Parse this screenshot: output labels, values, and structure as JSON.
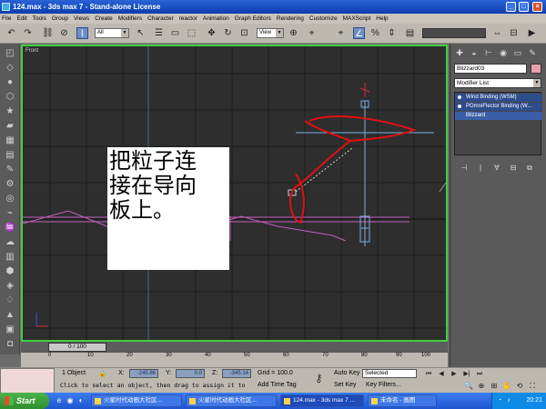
{
  "window": {
    "title": "124.max - 3ds max 7 - Stand-alone License",
    "minimize_glyph": "_",
    "maximize_glyph": "□",
    "close_glyph": "×"
  },
  "menubar": {
    "items": [
      "File",
      "Edit",
      "Tools",
      "Group",
      "Views",
      "Create",
      "Modifiers",
      "Character",
      "reactor",
      "Animation",
      "Graph Editors",
      "Rendering",
      "Customize",
      "MAXScript",
      "Help"
    ]
  },
  "toolbar": {
    "selection_filter": "All",
    "reference_coord": "View",
    "undo_glyph": "↶",
    "redo_glyph": "↷",
    "link_glyph": "⛓",
    "unlink_glyph": "⊘",
    "bind_spacewarp_glyph": "⌇",
    "select_glyph": "↖",
    "select_by_name_glyph": "☰",
    "region_glyph": "▭",
    "crossing_glyph": "⬚",
    "move_glyph": "✥",
    "rotate_glyph": "↻",
    "scale_glyph": "⊡",
    "pivot_glyph": "⊕",
    "snap_glyph": "⌖",
    "angle_snap_glyph": "∠",
    "percent_snap_glyph": "%",
    "spinner_snap_glyph": "⇕",
    "named_sel_glyph": "▤",
    "mirror_glyph": "⇔",
    "align_glyph": "⊟",
    "render_glyph": "☕",
    "quick_render_glyph": "▶"
  },
  "left_tools": {
    "glyphs": [
      "◰",
      "◇",
      "●",
      "⬡",
      "★",
      "▰",
      "▦",
      "▤",
      "✎",
      "⚙",
      "◎",
      "⌁",
      "♒",
      "☁",
      "▥",
      "⬢",
      "◈",
      "♢",
      "▲",
      "▣",
      "◘",
      "▨"
    ]
  },
  "viewport": {
    "label": "Front",
    "border_color": "#3fd03f",
    "grid_color": "#1e1e1e",
    "axis_color": "#000000"
  },
  "annotation": {
    "text": "把粒子连接在导向板上。"
  },
  "timebar": {
    "frame_display": "0 / 100",
    "ticks": [
      "0",
      "10",
      "20",
      "30",
      "40",
      "50",
      "60",
      "70",
      "80",
      "90",
      "100"
    ]
  },
  "command_panel": {
    "object_name": "Blizzard03",
    "object_color": "#e8a0a8",
    "modifier_list_label": "Modifier List",
    "stack": [
      "Wind Binding (WSM)",
      "POmniFlector Binding (W...",
      "Blizzard"
    ],
    "tab_glyphs": [
      "✚",
      "◒",
      "⊢",
      "◉",
      "▭",
      "✎"
    ],
    "stack_btn_glyphs": [
      "⊣",
      "|",
      "∀",
      "⊟",
      "⧉"
    ]
  },
  "status": {
    "object_count": "1 Object",
    "prompt": "Click to select an object, then drag to assign it to",
    "x_label": "X:",
    "x_value": "-245.86",
    "y_label": "Y:",
    "y_value": "0.0",
    "z_label": "Z:",
    "z_value": "-345.14",
    "grid": "Grid = 100.0",
    "add_time_tag": "Add Time Tag",
    "auto_key": "Auto Key",
    "auto_key_value": "Selected",
    "set_key": "Set Key",
    "key_filters": "Key Filters...",
    "key_glyph": "⚷",
    "lock_glyph": "🔒",
    "playback_glyphs": [
      "⏮",
      "◀",
      "▶",
      "▶|",
      "⏭"
    ],
    "nav_glyphs": [
      "🔍",
      "⊕",
      "⊞",
      "✋",
      "⟲",
      "⛶"
    ]
  },
  "taskbar": {
    "start_label": "Start",
    "quicklaunch_glyphs": [
      "e",
      "◉",
      "◐"
    ],
    "tasks": [
      "火星时代动画大社区...",
      "火星时代动画大社区...",
      "124.max - 3ds max 7 ...",
      "未命名 - 画图"
    ],
    "tray_glyphs": [
      "◔",
      "♪"
    ],
    "clock": "20:21"
  }
}
